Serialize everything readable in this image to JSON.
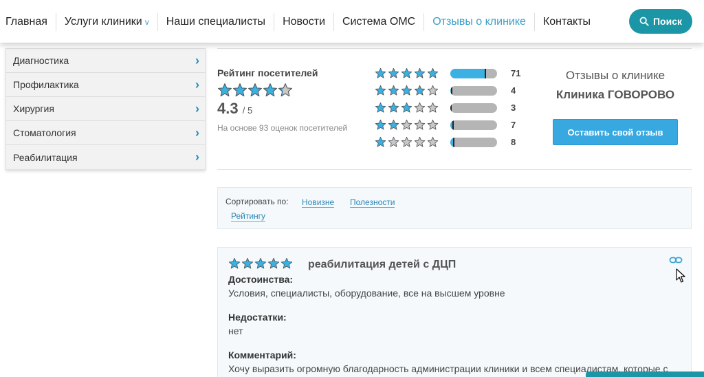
{
  "nav": {
    "items": [
      {
        "label": "Главная"
      },
      {
        "label": "Услуги клиники",
        "chevron": "v"
      },
      {
        "label": "Наши специалисты"
      },
      {
        "label": "Новости"
      },
      {
        "label": "Система ОМС"
      },
      {
        "label": "Отзывы о клинике",
        "active": true
      },
      {
        "label": "Контакты"
      }
    ],
    "search_label": "Поиск"
  },
  "sidebar": {
    "items": [
      {
        "label": "Диагностика"
      },
      {
        "label": "Профилактика"
      },
      {
        "label": "Хирургия"
      },
      {
        "label": "Стоматология"
      },
      {
        "label": "Реабилитация"
      }
    ]
  },
  "rating": {
    "title": "Рейтинг посетителей",
    "value": "4.3",
    "max": "/ 5",
    "stars_fraction": 0.86,
    "basis": "На основе 93 оценок посетителей",
    "distribution": [
      {
        "stars": 5,
        "count": "71",
        "fraction": 0.76
      },
      {
        "stars": 4,
        "count": "4",
        "fraction": 0.04
      },
      {
        "stars": 3,
        "count": "3",
        "fraction": 0.03
      },
      {
        "stars": 2,
        "count": "7",
        "fraction": 0.08
      },
      {
        "stars": 1,
        "count": "8",
        "fraction": 0.09
      }
    ]
  },
  "clinic": {
    "subtitle": "Отзывы о клинике",
    "name": "Клиника ГОВОРОВО",
    "review_button": "Оставить свой отзыв"
  },
  "sort": {
    "label": "Сортировать по:",
    "options": [
      "Новизне",
      "Полезности",
      "Рейтингу"
    ]
  },
  "review": {
    "stars": 5,
    "title": "реабилитация детей с ДЦП",
    "pros_label": "Достоинства:",
    "pros": "Условия, специалисты, оборудование, все на высшем уровне",
    "cons_label": "Недостатки:",
    "cons": "нет",
    "comment_label": "Комментарий:",
    "comment": "Хочу выразить огромную благодарность администрации клиники и всем специалистам, которые с"
  },
  "colors": {
    "accent": "#3a9ec9",
    "star_fill": "#3bb0e2",
    "teal": "#1a96a7"
  }
}
